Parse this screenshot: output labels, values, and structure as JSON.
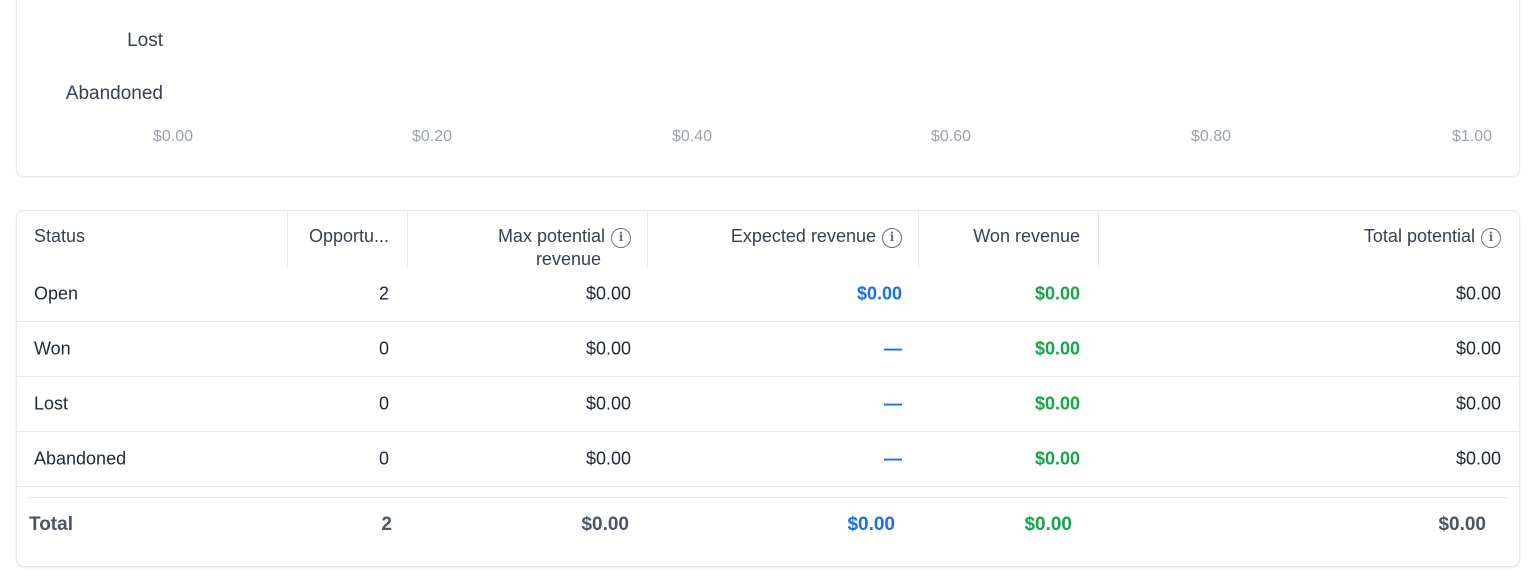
{
  "chart": {
    "y_categories": [
      "Lost",
      "Abandoned"
    ],
    "x_ticks": [
      "$0.00",
      "$0.20",
      "$0.40",
      "$0.60",
      "$0.80",
      "$1.00"
    ]
  },
  "table": {
    "headers": {
      "status": "Status",
      "opportunities": "Opportu...",
      "max_potential_line1": "Max potential",
      "max_potential_line2": "revenue",
      "expected_revenue": "Expected revenue",
      "won_revenue": "Won revenue",
      "total_potential": "Total potential"
    },
    "rows": [
      {
        "status": "Open",
        "opportunities": "2",
        "max_potential": "$0.00",
        "expected": "$0.00",
        "won": "$0.00",
        "total": "$0.00"
      },
      {
        "status": "Won",
        "opportunities": "0",
        "max_potential": "$0.00",
        "expected": "—",
        "won": "$0.00",
        "total": "$0.00"
      },
      {
        "status": "Lost",
        "opportunities": "0",
        "max_potential": "$0.00",
        "expected": "—",
        "won": "$0.00",
        "total": "$0.00"
      },
      {
        "status": "Abandoned",
        "opportunities": "0",
        "max_potential": "$0.00",
        "expected": "—",
        "won": "$0.00",
        "total": "$0.00"
      }
    ],
    "totals": {
      "label": "Total",
      "opportunities": "2",
      "max_potential": "$0.00",
      "expected": "$0.00",
      "won": "$0.00",
      "total": "$0.00"
    }
  },
  "colors": {
    "expected": "#1570ef",
    "won": "#16a34a"
  },
  "icons": {
    "info": "info-circle-icon"
  }
}
